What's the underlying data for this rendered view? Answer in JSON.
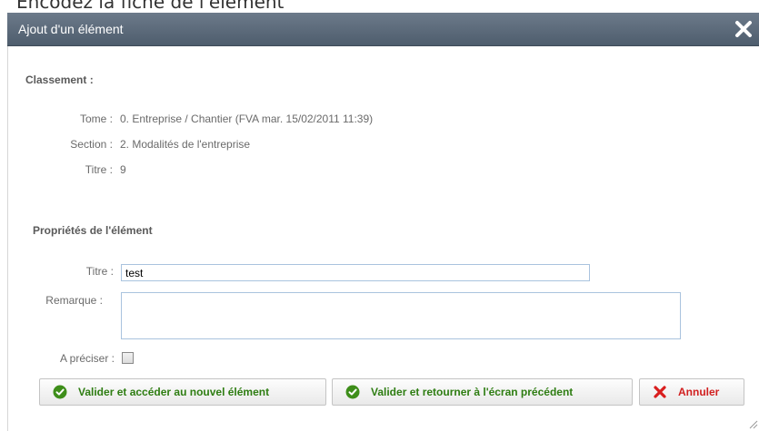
{
  "caption": "Encodez la fiche de l'élément",
  "dialog": {
    "title": "Ajout d'un élément"
  },
  "classement": {
    "heading": "Classement :",
    "tome_label": "Tome :",
    "tome_value": "0. Entreprise / Chantier (FVA mar. 15/02/2011 11:39)",
    "section_label": "Section :",
    "section_value": "2. Modalités de l'entreprise",
    "titre_label": "Titre :",
    "titre_value": "9"
  },
  "proprietes": {
    "heading": "Propriétés de l'élément",
    "titre_label": "Titre :",
    "titre_value": "test",
    "remarque_label": "Remarque :",
    "remarque_value": "",
    "preciser_label": "A préciser :",
    "preciser_checked": false
  },
  "buttons": {
    "validate_new": "Valider et accéder au nouvel élément",
    "validate_back": "Valider et retourner à l'écran précédent",
    "cancel": "Annuler"
  },
  "colors": {
    "titlebar": "#5d6b7b",
    "accept_green": "#2e7d12",
    "cancel_red": "#d12020"
  }
}
